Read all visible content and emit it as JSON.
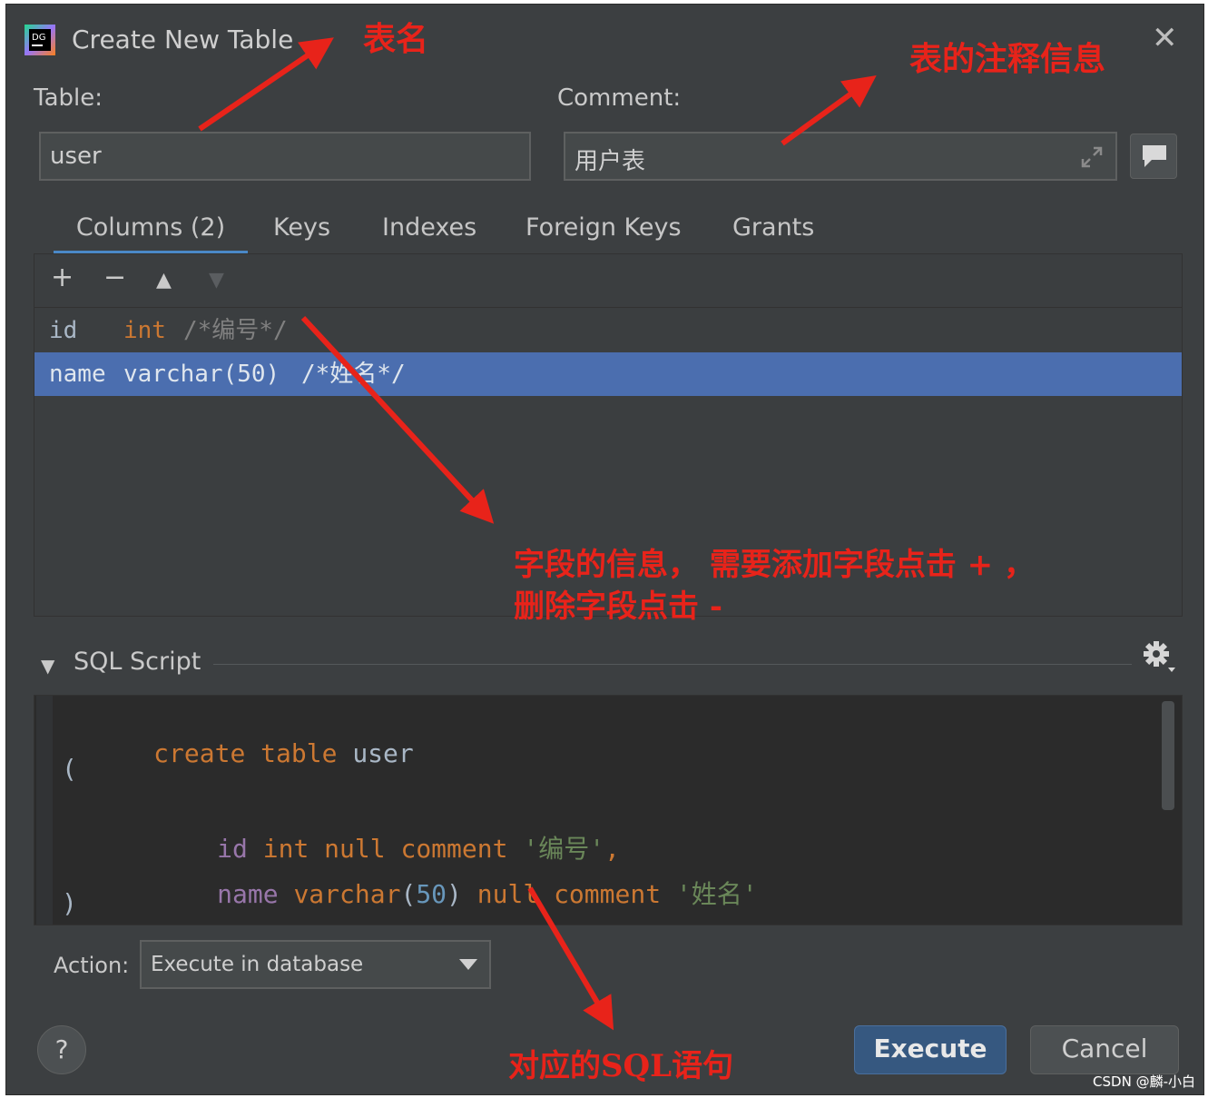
{
  "window": {
    "title": "Create New Table",
    "close_glyph": "✕",
    "app_icon": "datagrip-icon"
  },
  "form": {
    "table_label": "Table:",
    "table_value": "user",
    "comment_label": "Comment:",
    "comment_value": "用户表"
  },
  "tabs": [
    {
      "label": "Columns (2)",
      "active": true
    },
    {
      "label": "Keys"
    },
    {
      "label": "Indexes"
    },
    {
      "label": "Foreign Keys"
    },
    {
      "label": "Grants"
    }
  ],
  "columns_toolbar": {
    "add": "+",
    "remove": "−",
    "up": "▲",
    "down": "▼"
  },
  "columns": [
    {
      "name": "id",
      "type": "int",
      "comment": "/*编号*/",
      "selected": false
    },
    {
      "name": "name",
      "type": "varchar(50)",
      "comment": "/*姓名*/",
      "selected": true
    }
  ],
  "sql_section": {
    "title": "SQL Script"
  },
  "sql": {
    "line1": {
      "kw1": "create",
      "kw2": "table",
      "name": "user"
    },
    "line2": "(",
    "line3": {
      "name": "id",
      "type": "int",
      "null": "null",
      "comment_kw": "comment",
      "comment": "'编号'",
      "sep": ","
    },
    "line4": {
      "name": "name",
      "type": "varchar",
      "lp": "(",
      "size": "50",
      "rp": ")",
      "null": "null",
      "comment_kw": "comment",
      "comment": "'姓名'"
    },
    "line5": ")"
  },
  "action": {
    "label": "Action:",
    "value": "Execute in database"
  },
  "buttons": {
    "help": "?",
    "execute": "Execute",
    "cancel": "Cancel"
  },
  "annotations": {
    "table_name": "表名",
    "table_comment": "表的注释信息",
    "columns_info_1": "字段的信息， 需要添加字段点击 + ，",
    "columns_info_2": "删除字段点击 -",
    "sql_info": "对应的SQL语句"
  },
  "watermark": "CSDN @麟-小白",
  "colors": {
    "dialog_bg": "#3c3f41",
    "selected_row": "#4b6eaf",
    "execute_btn": "#365880",
    "annotation": "#e8231a"
  }
}
